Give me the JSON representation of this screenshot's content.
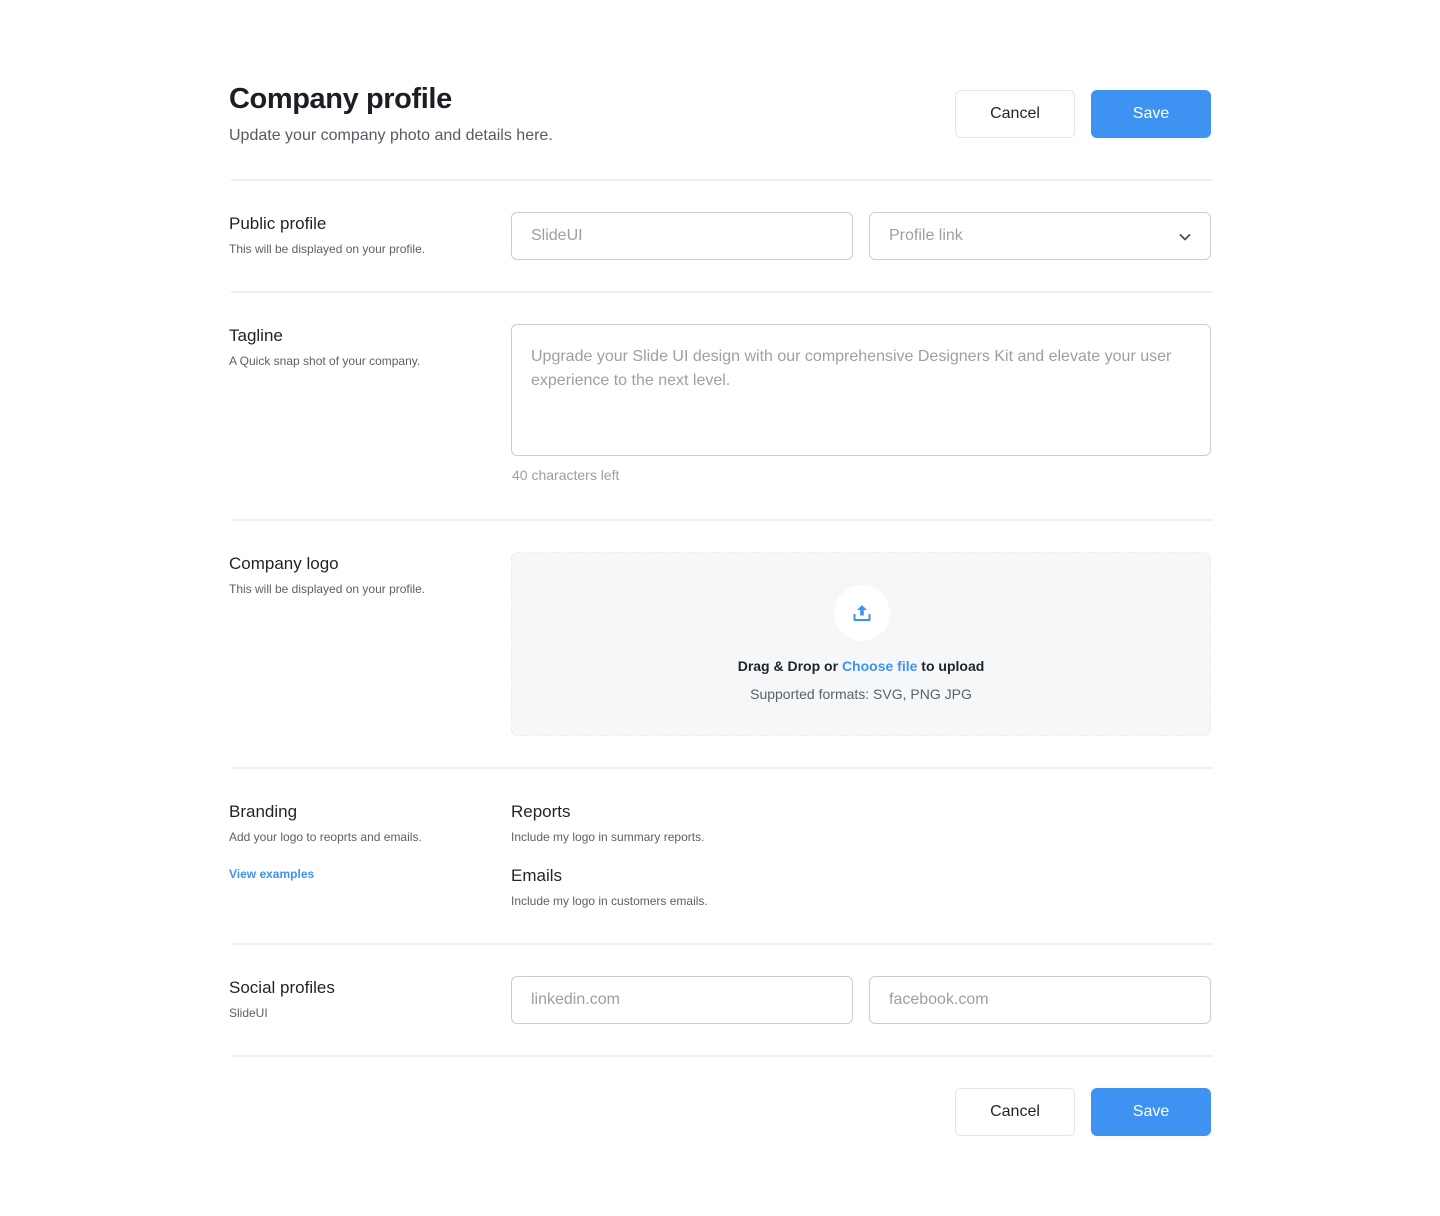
{
  "header": {
    "title": "Company profile",
    "subtitle": "Update your company photo and details here.",
    "cancel_label": "Cancel",
    "save_label": "Save"
  },
  "public_profile": {
    "title": "Public profile",
    "description": "This will be displayed on your profile.",
    "name_placeholder": "SlideUI",
    "link_select_value": "Profile link"
  },
  "tagline": {
    "title": "Tagline",
    "description": "A Quick snap shot of your company.",
    "placeholder": "Upgrade your Slide UI design with our comprehensive Designers Kit and elevate your user experience to the next level.",
    "chars_left": "40 characters left"
  },
  "company_logo": {
    "title": "Company logo",
    "description": "This will be displayed on your profile.",
    "upload_prefix": "Drag & Drop or",
    "upload_link": "Choose file",
    "upload_suffix": "to upload",
    "formats": "Supported formats: SVG, PNG JPG"
  },
  "branding": {
    "title": "Branding",
    "description": "Add your logo to reoprts and emails.",
    "link": "View examples",
    "options": [
      {
        "title": "Reports",
        "description": "Include my logo in summary reports."
      },
      {
        "title": "Emails",
        "description": "Include my logo in customers emails."
      }
    ]
  },
  "social_profiles": {
    "title": "Social profiles",
    "description": "SlideUI",
    "linkedin_placeholder": "linkedin.com",
    "facebook_placeholder": "facebook.com"
  },
  "footer": {
    "cancel_label": "Cancel",
    "save_label": "Save"
  },
  "colors": {
    "accent": "#3e93f2",
    "border": "#c9ccd1",
    "divider": "#eef0f2",
    "upload_bg": "#f6f7f9"
  }
}
